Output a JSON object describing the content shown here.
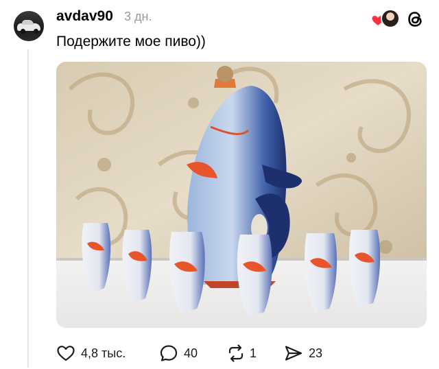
{
  "post": {
    "username": "avdav90",
    "time": "3 дн.",
    "text": "Подержите мое пиво))"
  },
  "actions": {
    "likes": "4,8 тыс.",
    "replies": "40",
    "reposts": "1",
    "shares": "23"
  },
  "icons": {
    "like": "heart-icon",
    "reply": "speech-bubble-icon",
    "repost": "repost-icon",
    "share": "paper-plane-icon",
    "brand": "threads-logo-icon",
    "reactor": "red-heart-icon"
  },
  "colors": {
    "text": "#000000",
    "muted": "#9a9a9a",
    "reaction_heart": "#ff3040",
    "thread_line": "#e4e4e4"
  }
}
